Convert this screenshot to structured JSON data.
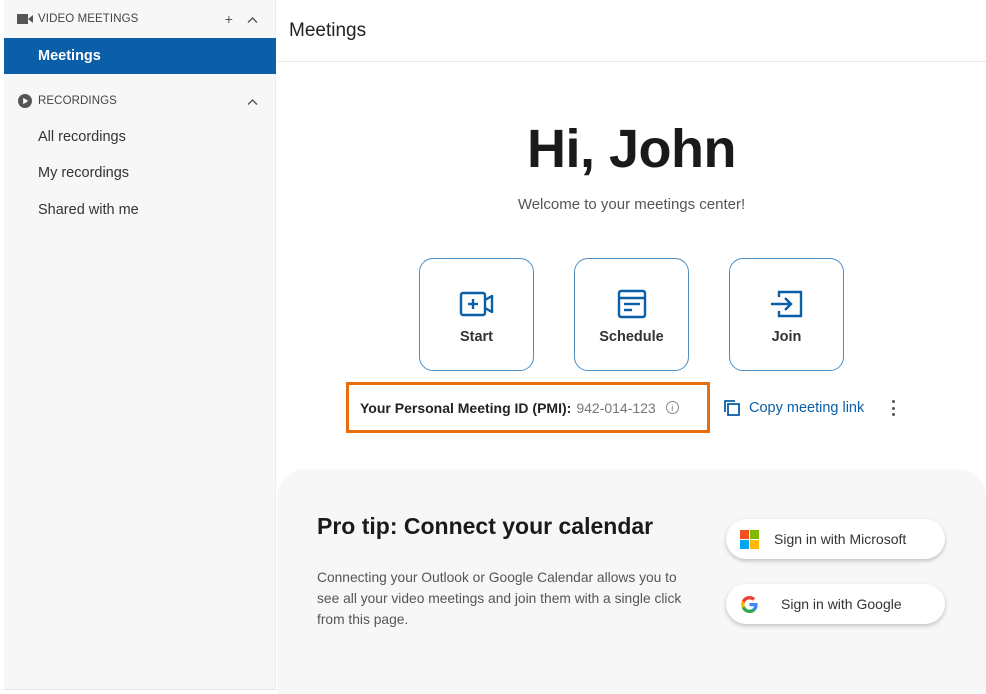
{
  "sidebar": {
    "video_meetings": {
      "label": "VIDEO MEETINGS",
      "icon": "video-camera-icon",
      "add_symbol": "+",
      "collapse_symbol": "^",
      "items": [
        {
          "label": "Meetings",
          "active": true
        }
      ]
    },
    "recordings": {
      "label": "RECORDINGS",
      "icon": "play-circle-icon",
      "collapse_symbol": "^",
      "items": [
        {
          "label": "All recordings"
        },
        {
          "label": "My recordings"
        },
        {
          "label": "Shared with me"
        }
      ]
    }
  },
  "header": {
    "title": "Meetings"
  },
  "welcome": {
    "greeting": "Hi, John",
    "subtitle": "Welcome to your meetings center!"
  },
  "actions": [
    {
      "label": "Start",
      "icon": "video-plus-icon"
    },
    {
      "label": "Schedule",
      "icon": "calendar-form-icon"
    },
    {
      "label": "Join",
      "icon": "enter-arrow-icon"
    }
  ],
  "pmi": {
    "label": "Your Personal Meeting ID (PMI):",
    "value": "942-014-123",
    "info_icon": "info-icon",
    "highlight_color": "#e66c0e"
  },
  "copy_link": {
    "label": "Copy meeting link",
    "icon": "copy-icon"
  },
  "pro_tip": {
    "title": "Pro tip: Connect your calendar",
    "body": "Connecting your Outlook or Google Calendar allows you to see all your video meetings and join them with a single click from this page.",
    "buttons": [
      {
        "label": "Sign in with Microsoft",
        "icon": "microsoft-logo-icon"
      },
      {
        "label": "Sign in with Google",
        "icon": "google-logo-icon"
      }
    ]
  },
  "colors": {
    "accent": "#0b5ea8",
    "button_border": "#4b8fc7",
    "sidebar_bg": "#f7f7f7"
  }
}
